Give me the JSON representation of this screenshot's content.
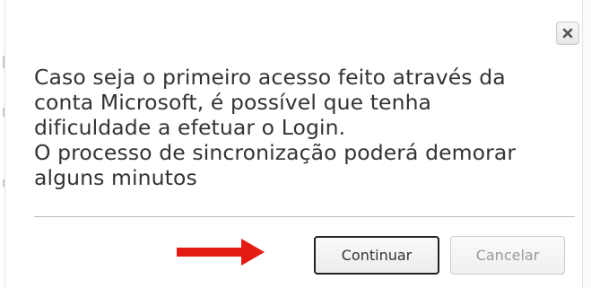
{
  "dialog": {
    "message_lines": [
      "Caso seja o primeiro acesso feito através da",
      "conta Microsoft, é possível que tenha",
      "dificuldade a efetuar o Login.",
      "O processo de sincronização poderá demorar",
      "alguns minutos"
    ],
    "buttons": {
      "continue_label": "Continuar",
      "cancel_label": "Cancelar",
      "cancel_state": "disabled"
    },
    "close_icon": "close-icon"
  },
  "colors": {
    "text": "#333333",
    "arrow": "#e41b13",
    "divider": "#bdbdbd",
    "continue_border": "#222222",
    "disabled_text": "#999999"
  }
}
